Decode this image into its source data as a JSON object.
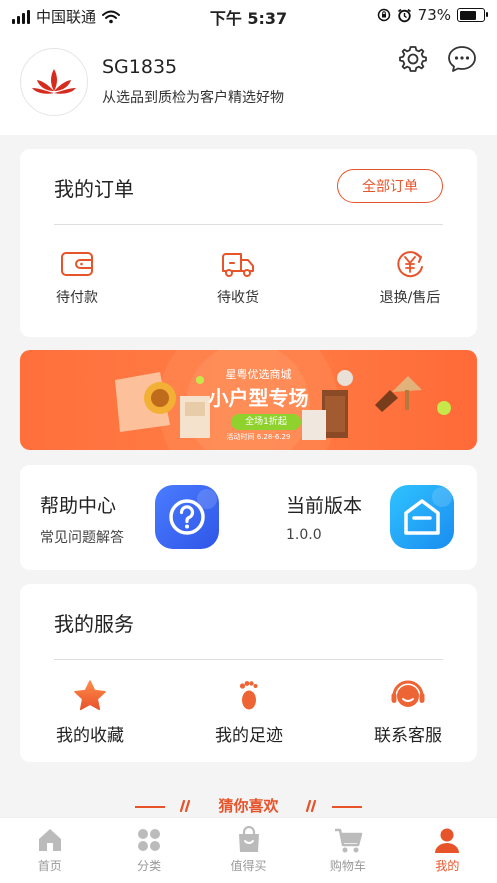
{
  "status_bar": {
    "carrier": "中国联通",
    "time": "下午 5:37",
    "battery_percent": "73%",
    "battery_level": 0.73
  },
  "profile": {
    "name": "SG1835",
    "description": "从选品到质检为客户精选好物"
  },
  "orders": {
    "title": "我的订单",
    "all_orders_label": "全部订单",
    "items": [
      {
        "label": "待付款",
        "icon": "wallet-icon"
      },
      {
        "label": "待收货",
        "icon": "truck-icon"
      },
      {
        "label": "退换/售后",
        "icon": "yen-refund-icon"
      }
    ]
  },
  "banner": {
    "brand": "星粤优选商城",
    "headline": "小户型专场",
    "tag": "全场1折起",
    "date": "活动时间 6.28-6.29"
  },
  "help": {
    "title": "帮助中心",
    "subtitle": "常见问题解答",
    "icon": "question-app-icon"
  },
  "version": {
    "title": "当前版本",
    "value": "1.0.0",
    "icon": "version-app-icon"
  },
  "services": {
    "title": "我的服务",
    "items": [
      {
        "label": "我的收藏",
        "icon": "star-icon"
      },
      {
        "label": "我的足迹",
        "icon": "footprint-icon"
      },
      {
        "label": "联系客服",
        "icon": "headset-icon"
      }
    ]
  },
  "guess": {
    "label": "猜你喜欢"
  },
  "tabbar": {
    "items": [
      {
        "label": "首页",
        "icon": "home-icon"
      },
      {
        "label": "分类",
        "icon": "category-icon"
      },
      {
        "label": "值得买",
        "icon": "bag-icon"
      },
      {
        "label": "购物车",
        "icon": "cart-icon"
      },
      {
        "label": "我的",
        "icon": "user-icon"
      }
    ],
    "active_index": 4
  },
  "colors": {
    "accent": "#e8542a",
    "tab_inactive": "#999999",
    "background": "#f4f4f5"
  }
}
